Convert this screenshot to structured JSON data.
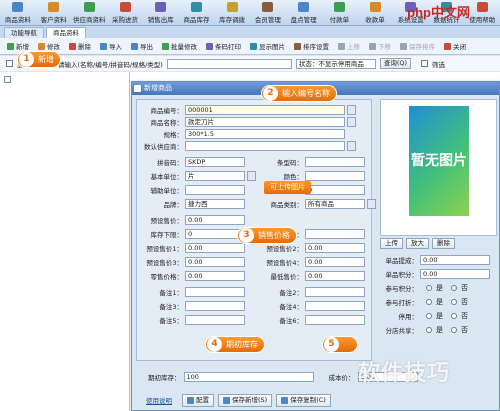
{
  "menu": {
    "items": [
      "商品资料",
      "客户资料",
      "供应商资料",
      "采购进货",
      "销售出库",
      "商品库存",
      "库存调拨",
      "会员管理",
      "盘点管理",
      "付款单",
      "收款单",
      "系统设置",
      "数据统计",
      "使用帮助"
    ],
    "logo": "php中文网"
  },
  "tabs": [
    {
      "label": "功能导航"
    },
    {
      "label": "商品资料"
    }
  ],
  "toolbar": {
    "buttons": [
      "新增",
      "修改",
      "删除",
      "导入",
      "导出",
      "批量修改",
      "条码打印",
      "显示图片",
      "排序设置",
      "上移",
      "下移",
      "保存排序",
      "关闭"
    ]
  },
  "filter": {
    "show_all_label": "显示",
    "search_hint": "请输入(名称/编号/拼音码/规格/类型)",
    "status_select": "状态：不显示停用商品",
    "search_button": "查询(Q)",
    "filter_label": "筛选"
  },
  "dialog": {
    "title": "新增商品",
    "fields": {
      "code": {
        "label": "商品编号：",
        "value": "000001"
      },
      "name": {
        "label": "商品名称：",
        "value": "款定刀片"
      },
      "spec": {
        "label": "规格：",
        "value": "300*1.5"
      },
      "custom_code": {
        "label": "数认供应商：",
        "value": ""
      },
      "pinyin": {
        "label": "拼音码：",
        "value": "SKDP"
      },
      "model": {
        "label": "条型码：",
        "value": ""
      },
      "unit": {
        "label": "基本单位：",
        "value": "片"
      },
      "color": {
        "label": "颜色：",
        "value": ""
      },
      "aux_unit": {
        "label": "辅助单位：",
        "value": ""
      },
      "aux_count": {
        "label": "辅助数量：",
        "value": "0"
      },
      "brand": {
        "label": "品牌：",
        "value": "捷力西"
      },
      "category": {
        "label": "商品类别：",
        "value": "所有商品"
      },
      "presale_price": {
        "label": "预设售价：",
        "value": "0.00"
      },
      "stock_min": {
        "label": "库存下限：",
        "value": "0"
      },
      "stock_max": {
        "label": "库存上限：",
        "value": ""
      },
      "price1": {
        "label": "预设售价1：",
        "value": "0.00"
      },
      "price2": {
        "label": "预设售价2：",
        "value": "0.00"
      },
      "price3": {
        "label": "预设售价3：",
        "value": "0.00"
      },
      "price4": {
        "label": "预设售价4：",
        "value": "0.00"
      },
      "retail_price": {
        "label": "零售价格：",
        "value": "0.00"
      },
      "lowest_price": {
        "label": "最低售价：",
        "value": "0.00"
      },
      "note1": {
        "label": "备注1：",
        "value": ""
      },
      "note2": {
        "label": "备注2：",
        "value": ""
      },
      "note3": {
        "label": "备注3：",
        "value": ""
      },
      "note4": {
        "label": "备注4：",
        "value": ""
      },
      "note5": {
        "label": "备注5：",
        "value": ""
      },
      "note6": {
        "label": "备注6：",
        "value": ""
      }
    },
    "image": {
      "placeholder": "暂无图片",
      "upload": "上传",
      "enlarge": "放大",
      "delete": "删除",
      "upload_hint": "可上传图片"
    },
    "right_fields": {
      "points_ratio": {
        "label": "单品提成：",
        "value": "0.00"
      },
      "points": {
        "label": "单品积分：",
        "value": "0.00"
      },
      "join_points": {
        "label": "参与积分：",
        "yes": "是",
        "no": "否"
      },
      "join_discount": {
        "label": "参与打折：",
        "yes": "是",
        "no": "否"
      },
      "disabled": {
        "label": "停用：",
        "yes": "是",
        "no": "否"
      },
      "split": {
        "label": "分店共享：",
        "yes": "是",
        "no": "否"
      }
    },
    "bottom": {
      "opening_stock_label": "期初库存：",
      "opening_stock_value": "100",
      "cost_label": "成本价：",
      "cost_value": "6.00"
    },
    "buttons": {
      "help": "使用说明",
      "config": "配置",
      "save_add": "保存新增(S)",
      "save_copy": "保存复制(C)",
      "close": "关闭"
    }
  },
  "callouts": [
    {
      "num": "1",
      "text": "新增"
    },
    {
      "num": "2",
      "text": "输入编号名称"
    },
    {
      "num": "3",
      "text": "销售价格"
    },
    {
      "num": "4",
      "text": "期初库存"
    },
    {
      "num": "5",
      "text": ""
    }
  ],
  "watermark": "软件技巧"
}
